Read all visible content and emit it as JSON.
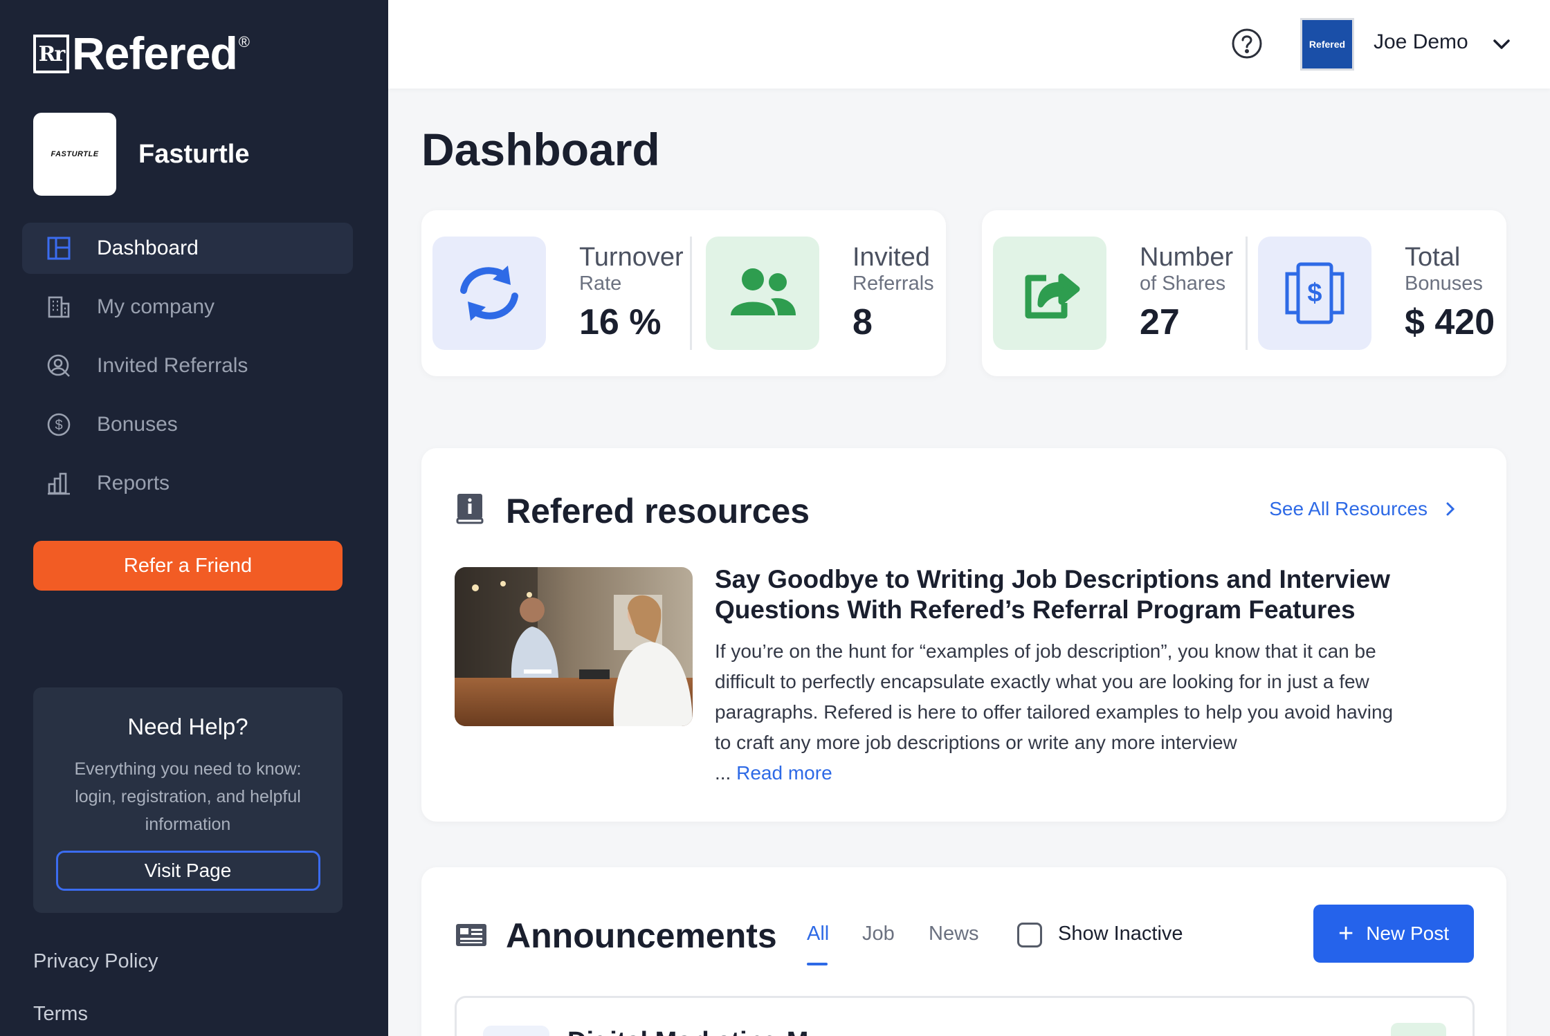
{
  "brand": {
    "name": "Refered",
    "mark": "Rr",
    "reg": "®"
  },
  "company": {
    "name": "Fasturtle",
    "logo_text": "FASTURTLE"
  },
  "sidebar": {
    "items": [
      {
        "label": "Dashboard",
        "icon": "layout-icon",
        "active": true
      },
      {
        "label": "My company",
        "icon": "building-icon",
        "active": false
      },
      {
        "label": "Invited Referrals",
        "icon": "user-search-icon",
        "active": false
      },
      {
        "label": "Bonuses",
        "icon": "dollar-circle-icon",
        "active": false
      },
      {
        "label": "Reports",
        "icon": "bar-chart-icon",
        "active": false
      }
    ],
    "refer_button": "Refer a Friend",
    "help": {
      "title": "Need Help?",
      "text": "Everything you need to know: login, registration, and helpful information",
      "button": "Visit Page"
    },
    "footer": {
      "privacy": "Privacy Policy",
      "terms": "Terms"
    }
  },
  "topbar": {
    "help_icon": "question-circle-icon",
    "avatar_text": "Refered",
    "user_name": "Joe Demo",
    "dropdown_icon": "chevron-down-icon"
  },
  "page": {
    "title": "Dashboard"
  },
  "stats": [
    {
      "label1": "Turnover",
      "label2": "Rate",
      "value": "16 %",
      "icon": "refresh-icon"
    },
    {
      "label1": "Invited",
      "label2": "Referrals",
      "value": "8",
      "icon": "users-icon"
    },
    {
      "label1": "Number",
      "label2": "of Shares",
      "value": "27",
      "icon": "share-icon"
    },
    {
      "label1": "Total",
      "label2": "Bonuses",
      "value": "$ 420",
      "icon": "bill-icon"
    }
  ],
  "resources": {
    "title": "Refered resources",
    "see_all": "See All Resources",
    "article": {
      "title": "Say Goodbye to Writing Job Descriptions and Interview Questions With Refered’s Referral Program Features",
      "excerpt": "If you’re on the hunt for “examples of job description”, you know that it can be difficult to perfectly encapsulate exactly what you are looking for in just a few paragraphs. Refered is here to offer tailored examples to help you avoid having to craft any more job descriptions or write any more interview",
      "ellipsis": "...",
      "read_more": "Read more"
    }
  },
  "announcements": {
    "title": "Announcements",
    "tabs": [
      "All",
      "Job",
      "News"
    ],
    "show_inactive": "Show Inactive",
    "new_post": "New Post",
    "first_item_title": "Digital Marketing M"
  },
  "colors": {
    "sidebar_bg": "#1c2335",
    "accent_orange": "#f25c24",
    "accent_blue": "#2563eb",
    "icon_blue": "#2e6ae6",
    "icon_green": "#2e9d4f"
  }
}
